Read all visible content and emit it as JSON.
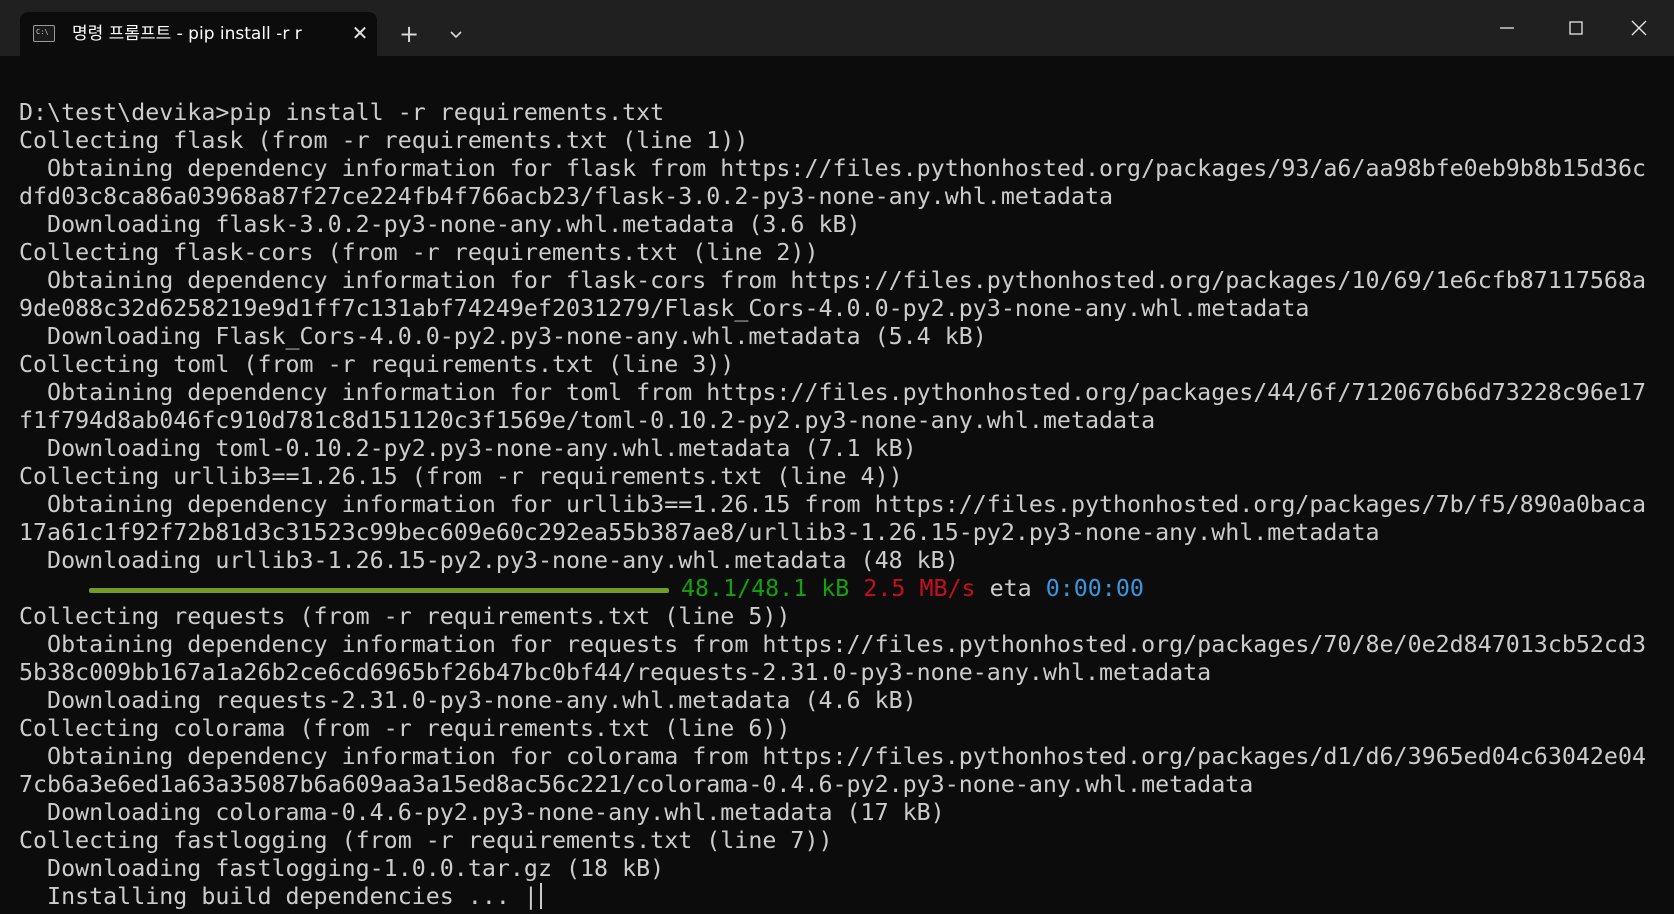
{
  "window": {
    "tab_title": "명령 프롬프트 - pip  install -r r",
    "tab_icon_text": "C:\\",
    "close_tab_glyph": "✕",
    "new_tab_glyph": "+",
    "dropdown_icon": "chevron-down-icon",
    "controls": [
      "minimize-icon",
      "maximize-icon",
      "close-icon"
    ]
  },
  "terminal": {
    "lines": [
      "D:\\test\\devika>pip install -r requirements.txt",
      "Collecting flask (from -r requirements.txt (line 1))",
      "  Obtaining dependency information for flask from https://files.pythonhosted.org/packages/93/a6/aa98bfe0eb9b8b15d36c",
      "dfd03c8ca86a03968a87f27ce224fb4f766acb23/flask-3.0.2-py3-none-any.whl.metadata",
      "  Downloading flask-3.0.2-py3-none-any.whl.metadata (3.6 kB)",
      "Collecting flask-cors (from -r requirements.txt (line 2))",
      "  Obtaining dependency information for flask-cors from https://files.pythonhosted.org/packages/10/69/1e6cfb87117568a",
      "9de088c32d6258219e9d1ff7c131abf74249ef2031279/Flask_Cors-4.0.0-py2.py3-none-any.whl.metadata",
      "  Downloading Flask_Cors-4.0.0-py2.py3-none-any.whl.metadata (5.4 kB)",
      "Collecting toml (from -r requirements.txt (line 3))",
      "  Obtaining dependency information for toml from https://files.pythonhosted.org/packages/44/6f/7120676b6d73228c96e17",
      "f1f794d8ab046fc910d781c8d151120c3f1569e/toml-0.10.2-py2.py3-none-any.whl.metadata",
      "  Downloading toml-0.10.2-py2.py3-none-any.whl.metadata (7.1 kB)",
      "Collecting urllib3==1.26.15 (from -r requirements.txt (line 4))",
      "  Obtaining dependency information for urllib3==1.26.15 from https://files.pythonhosted.org/packages/7b/f5/890a0baca",
      "17a61c1f92f72b81d3c31523c99bec609e60c292ea55b387ae8/urllib3-1.26.15-py2.py3-none-any.whl.metadata",
      "  Downloading urllib3-1.26.15-py2.py3-none-any.whl.metadata (48 kB)"
    ],
    "progress": {
      "fraction": 1.0,
      "amount": "48.1/48.1 kB",
      "speed": "2.5 MB/s",
      "eta_label": "eta",
      "eta": "0:00:00",
      "colors": {
        "bar": "#729c25",
        "amount": "#13a10e",
        "speed": "#c50f1f",
        "eta": "#3a96dd"
      }
    },
    "lines_after": [
      "Collecting requests (from -r requirements.txt (line 5))",
      "  Obtaining dependency information for requests from https://files.pythonhosted.org/packages/70/8e/0e2d847013cb52cd3",
      "5b38c009bb167a1a26b2ce6cd6965bf26b47bc0bf44/requests-2.31.0-py3-none-any.whl.metadata",
      "  Downloading requests-2.31.0-py3-none-any.whl.metadata (4.6 kB)",
      "Collecting colorama (from -r requirements.txt (line 6))",
      "  Obtaining dependency information for colorama from https://files.pythonhosted.org/packages/d1/d6/3965ed04c63042e04",
      "7cb6a3e6ed1a63a35087b6a609aa3a15ed8ac56c221/colorama-0.4.6-py2.py3-none-any.whl.metadata",
      "  Downloading colorama-0.4.6-py2.py3-none-any.whl.metadata (17 kB)",
      "Collecting fastlogging (from -r requirements.txt (line 7))",
      "  Downloading fastlogging-1.0.0.tar.gz (18 kB)",
      "  Installing build dependencies ... |"
    ],
    "colors": {
      "background": "#0c0c0c",
      "foreground": "#cccccc",
      "titlebar": "#202020"
    }
  }
}
